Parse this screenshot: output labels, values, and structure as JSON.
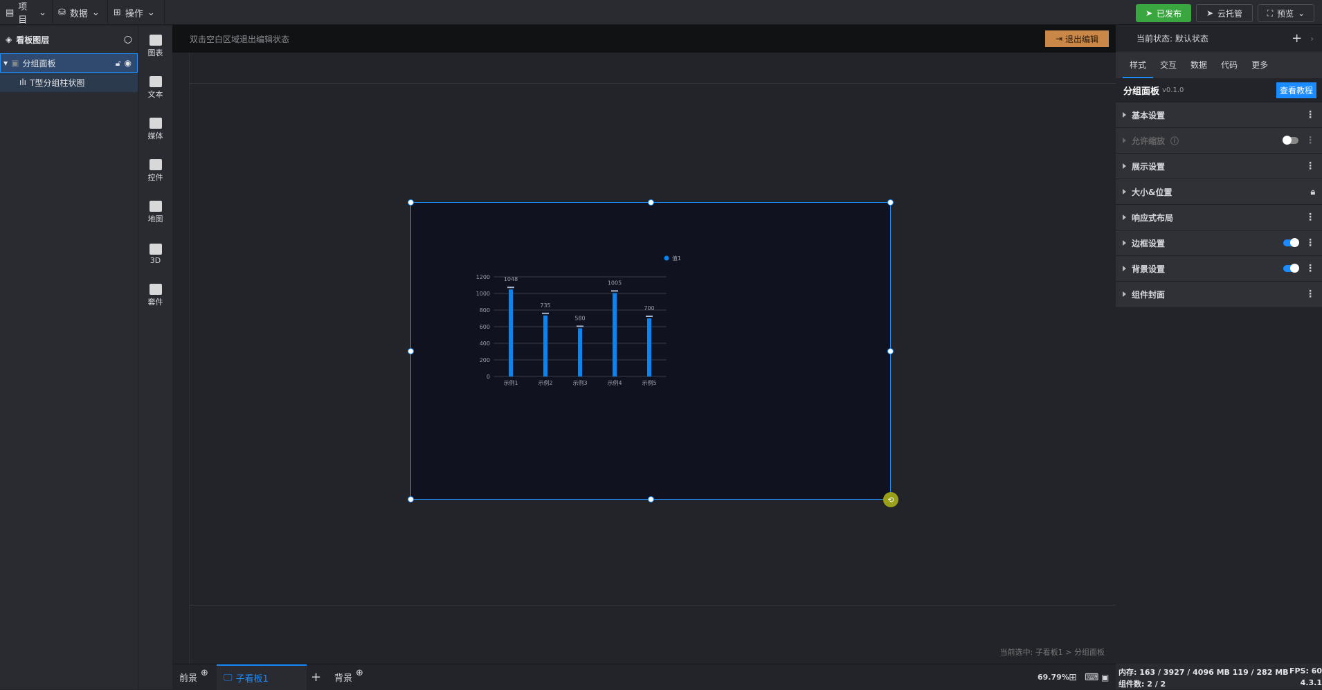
{
  "topbar": {
    "menus": [
      {
        "icon": "file-icon",
        "label": "项目"
      },
      {
        "icon": "database-icon",
        "label": "数据"
      },
      {
        "icon": "grid-icon",
        "label": "操作"
      }
    ],
    "publish": "已发布",
    "cloud": "云托管",
    "preview": "预览"
  },
  "layers": {
    "title": "看板图层",
    "items": [
      {
        "label": "分组面板"
      },
      {
        "label": "T型分组柱状图"
      }
    ]
  },
  "iconbar": [
    {
      "icon": "bar-chart-icon",
      "label": "图表"
    },
    {
      "icon": "crown-icon",
      "label": "文本"
    },
    {
      "icon": "camera-icon",
      "label": "媒体"
    },
    {
      "icon": "form-icon",
      "label": "控件"
    },
    {
      "icon": "map-icon",
      "label": "地图"
    },
    {
      "icon": "cube-icon",
      "label": "3D"
    },
    {
      "icon": "shirt-icon",
      "label": "套件"
    }
  ],
  "canvas": {
    "hint": "双击空白区域退出编辑状态",
    "exit": "退出编辑",
    "selection": "当前选中: 子看板1 > 分组面板"
  },
  "chart_data": {
    "type": "bar",
    "categories": [
      "示例1",
      "示例2",
      "示例3",
      "示例4",
      "示例5"
    ],
    "series": [
      {
        "name": "值1",
        "values": [
          1048,
          735,
          580,
          1005,
          700
        ]
      }
    ],
    "ylim": [
      0,
      1200
    ],
    "yticks": [
      "0",
      "200",
      "400",
      "600",
      "800",
      "1000",
      "1200"
    ],
    "legend": "top-right",
    "color": "#0a84f0",
    "grid": true
  },
  "right": {
    "state": "当前状态: 默认状态",
    "tabs": [
      "样式",
      "交互",
      "数据",
      "代码",
      "更多"
    ],
    "component": "分组面板",
    "version": "v0.1.0",
    "tutorial": "查看教程",
    "rows": [
      {
        "label": "基本设置"
      },
      {
        "label": "允许缩放"
      },
      {
        "label": "展示设置"
      },
      {
        "label": "大小&位置"
      },
      {
        "label": "响应式布局"
      },
      {
        "label": "边框设置"
      },
      {
        "label": "背景设置"
      },
      {
        "label": "组件封面"
      }
    ]
  },
  "bottom": {
    "front": "前景",
    "subboard": "子看板1",
    "back": "背景",
    "zoom": "69.79%"
  },
  "status": {
    "memory": "内存: 163 / 3927 / 4096 MB  119 / 282 MB",
    "fps": "FPS: 60",
    "count": "组件数: 2 / 2",
    "version": "4.3.1"
  }
}
